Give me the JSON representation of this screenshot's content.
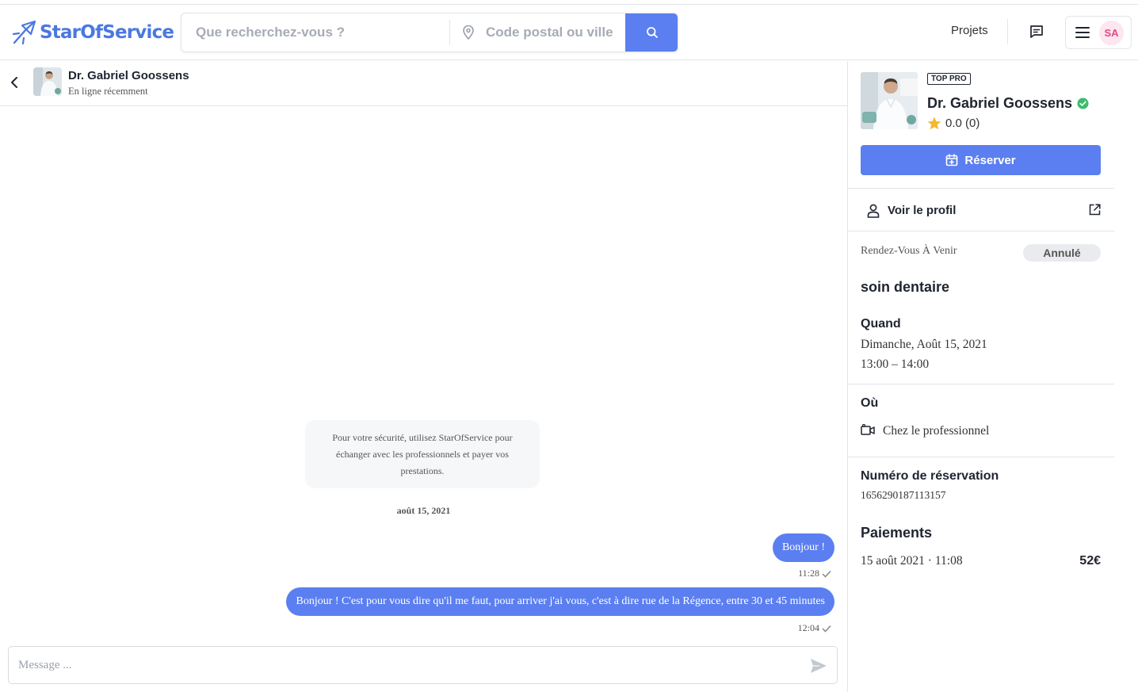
{
  "header": {
    "brand": "StarOfService",
    "search_placeholder": "Que recherchez-vous ?",
    "location_placeholder": "Code postal ou ville",
    "nav_projets": "Projets",
    "user_initials": "SA",
    "accent_color": "#5b7ff0",
    "icons": [
      "star-logo-icon",
      "pin-icon",
      "search-icon",
      "message-icon",
      "menu-icon"
    ]
  },
  "chat": {
    "pro_name": "Dr. Gabriel Goossens",
    "status": "En ligne récemment",
    "security_note": "Pour votre sécurité, utilisez StarOfService pour échanger avec les professionnels et payer vos prestations.",
    "date_separator": "août 15, 2021",
    "messages": [
      {
        "text": "Bonjour !",
        "time": "11:28",
        "read_icon": "check-icon"
      },
      {
        "text": "Bonjour ! C'est pour vous dire qu'il me faut, pour arriver j'ai vous, c'est à dire rue de la Régence, entre 30 et 45 minutes",
        "time": "12:04",
        "read_icon": "check-icon"
      }
    ],
    "composer_placeholder": "Message ..."
  },
  "panel": {
    "badge": "TOP PRO",
    "pro_name": "Dr. Gabriel Goossens",
    "rating": "0.0 (0)",
    "reserve_label": "Réserver",
    "profile_label": "Voir le profil",
    "rdv_label": "Rendez-Vous À Venir",
    "rdv_status": "Annulé",
    "service": "soin dentaire",
    "quand_title": "Quand",
    "quand_date": "Dimanche, Août 15, 2021",
    "quand_time": "13:00 – 14:00",
    "ou_title": "Où",
    "ou_value": "Chez le professionnel",
    "num_title": "Numéro de réservation",
    "num_value": "1656290187113157",
    "pay_title": "Paiements",
    "pay_date": "15 août 2021 · 11:08",
    "pay_amount": "52€",
    "verified_color": "#3dbb6e",
    "star_color": "#f5b82e"
  }
}
